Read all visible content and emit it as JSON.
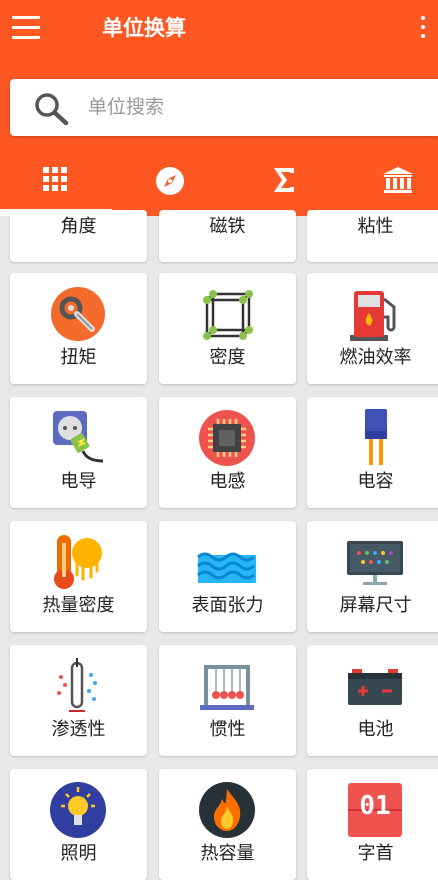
{
  "app": {
    "title": "单位换算",
    "search_placeholder": "单位搜索",
    "accent_color": "#ff5722"
  },
  "tabs": [
    {
      "icon": "grid-icon",
      "active": true
    },
    {
      "icon": "compass-icon",
      "active": false
    },
    {
      "icon": "sigma-icon",
      "active": false
    },
    {
      "icon": "bank-icon",
      "active": false
    }
  ],
  "units": [
    {
      "label": "角度",
      "icon": "angle-icon"
    },
    {
      "label": "磁铁",
      "icon": "magnet-icon"
    },
    {
      "label": "粘性",
      "icon": "viscosity-icon"
    },
    {
      "label": "扭矩",
      "icon": "torque-icon"
    },
    {
      "label": "密度",
      "icon": "density-icon"
    },
    {
      "label": "燃油效率",
      "icon": "fuel-pump-icon"
    },
    {
      "label": "电导",
      "icon": "power-plug-icon"
    },
    {
      "label": "电感",
      "icon": "chip-icon"
    },
    {
      "label": "电容",
      "icon": "capacitor-icon"
    },
    {
      "label": "热量密度",
      "icon": "thermometer-sun-icon"
    },
    {
      "label": "表面张力",
      "icon": "water-waves-icon"
    },
    {
      "label": "屏幕尺寸",
      "icon": "monitor-icon"
    },
    {
      "label": "渗透性",
      "icon": "permeability-icon"
    },
    {
      "label": "惯性",
      "icon": "newtons-cradle-icon"
    },
    {
      "label": "电池",
      "icon": "battery-icon"
    },
    {
      "label": "照明",
      "icon": "light-bulb-icon"
    },
    {
      "label": "热容量",
      "icon": "flame-icon"
    },
    {
      "label": "字首",
      "icon": "prefix-01-icon",
      "prefix_text": "01"
    }
  ]
}
